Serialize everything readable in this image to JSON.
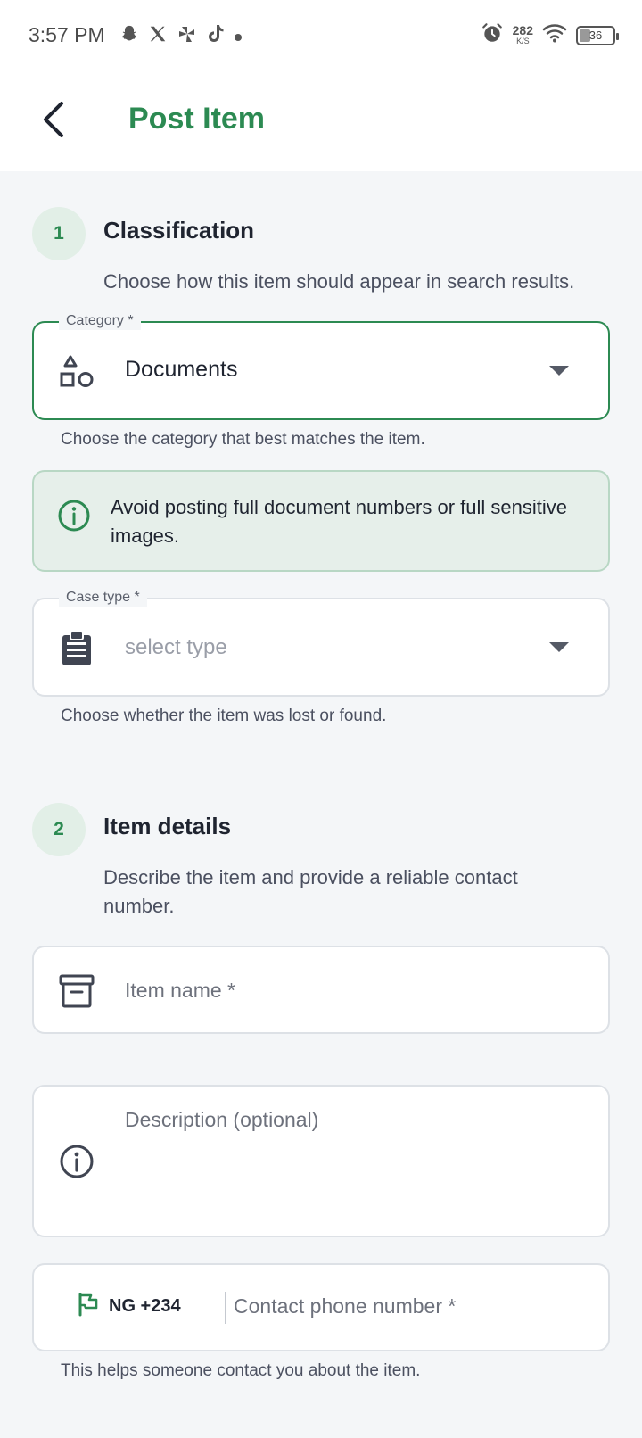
{
  "status_bar": {
    "time": "3:57 PM",
    "apps": [
      "snapchat-icon",
      "x-icon",
      "pinwheel-icon",
      "tiktok-icon",
      "dot-icon"
    ],
    "net_speed_value": "282",
    "net_speed_unit": "K/S",
    "battery": "36"
  },
  "header": {
    "title": "Post Item",
    "back_icon": "chevron-left-icon"
  },
  "section1": {
    "step": "1",
    "title": "Classification",
    "description": "Choose how this item should appear in search results.",
    "category": {
      "label": "Category *",
      "value": "Documents",
      "icon": "shapes-icon",
      "helper": "Choose the category that best matches the item."
    },
    "notice": {
      "icon": "info-icon",
      "text": "Avoid posting full document numbers or full sensitive images."
    },
    "case_type": {
      "label": "Case type *",
      "placeholder": "select type",
      "icon": "clipboard-icon",
      "helper": "Choose whether the item was lost or found."
    }
  },
  "section2": {
    "step": "2",
    "title": "Item details",
    "description": "Describe the item and provide a reliable contact number.",
    "item_name": {
      "placeholder": "Item name *",
      "icon": "archive-icon"
    },
    "description_field": {
      "placeholder": "Description (optional)",
      "icon": "info-icon"
    },
    "phone": {
      "country_icon": "flag-icon",
      "country_code": "NG +234",
      "placeholder": "Contact phone number *",
      "helper": "This helps someone contact you about the item."
    }
  },
  "colors": {
    "accent": "#2c8a52",
    "accent_soft": "#e2efe7",
    "page_bg": "#f4f6f8",
    "border": "#dde1e6"
  }
}
